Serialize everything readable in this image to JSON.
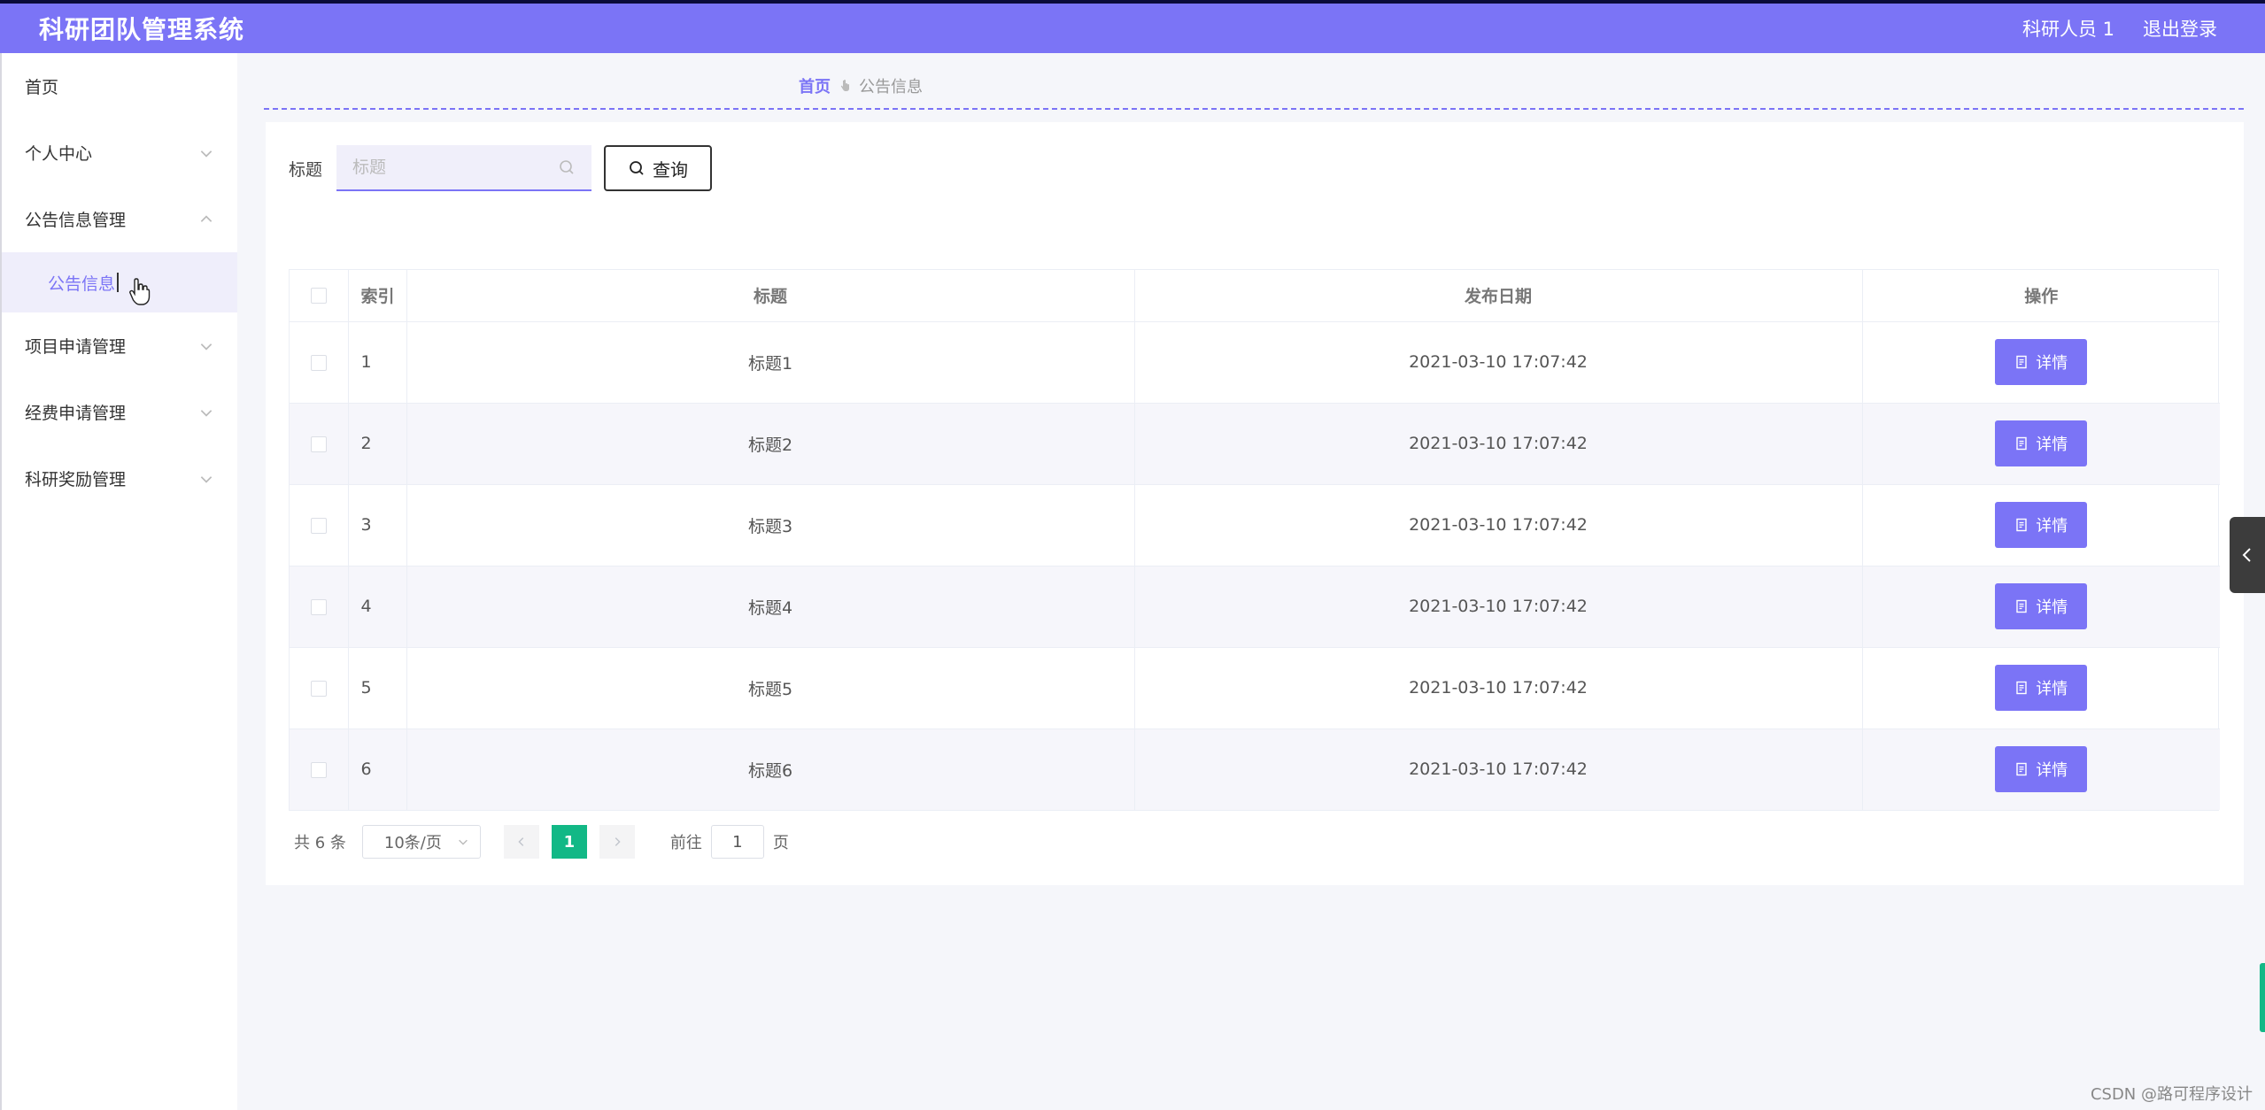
{
  "app": {
    "title": "科研团队管理系统",
    "user": "科研人员 1",
    "logout": "退出登录"
  },
  "sidebar": {
    "items": [
      {
        "label": "首页"
      },
      {
        "label": "个人中心"
      },
      {
        "label": "公告信息管理"
      },
      {
        "label": "项目申请管理"
      },
      {
        "label": "经费申请管理"
      },
      {
        "label": "科研奖励管理"
      }
    ],
    "sub_active": "公告信息"
  },
  "breadcrumb": {
    "home": "首页",
    "current": "公告信息"
  },
  "search": {
    "label": "标题",
    "placeholder": "标题",
    "button": "查询"
  },
  "table": {
    "columns": [
      "索引",
      "标题",
      "发布日期",
      "操作"
    ],
    "rows": [
      {
        "index": "1",
        "title": "标题1",
        "date": "2021-03-10 17:07:42",
        "action": "详情"
      },
      {
        "index": "2",
        "title": "标题2",
        "date": "2021-03-10 17:07:42",
        "action": "详情"
      },
      {
        "index": "3",
        "title": "标题3",
        "date": "2021-03-10 17:07:42",
        "action": "详情"
      },
      {
        "index": "4",
        "title": "标题4",
        "date": "2021-03-10 17:07:42",
        "action": "详情"
      },
      {
        "index": "5",
        "title": "标题5",
        "date": "2021-03-10 17:07:42",
        "action": "详情"
      },
      {
        "index": "6",
        "title": "标题6",
        "date": "2021-03-10 17:07:42",
        "action": "详情"
      }
    ]
  },
  "pagination": {
    "total": "共 6 条",
    "page_size": "10条/页",
    "current_page": "1",
    "goto_prefix": "前往",
    "goto_value": "1",
    "goto_suffix": "页"
  },
  "watermark": "CSDN @路可程序设计",
  "colors": {
    "accent": "#7b74f6",
    "active_page": "#12b886"
  }
}
